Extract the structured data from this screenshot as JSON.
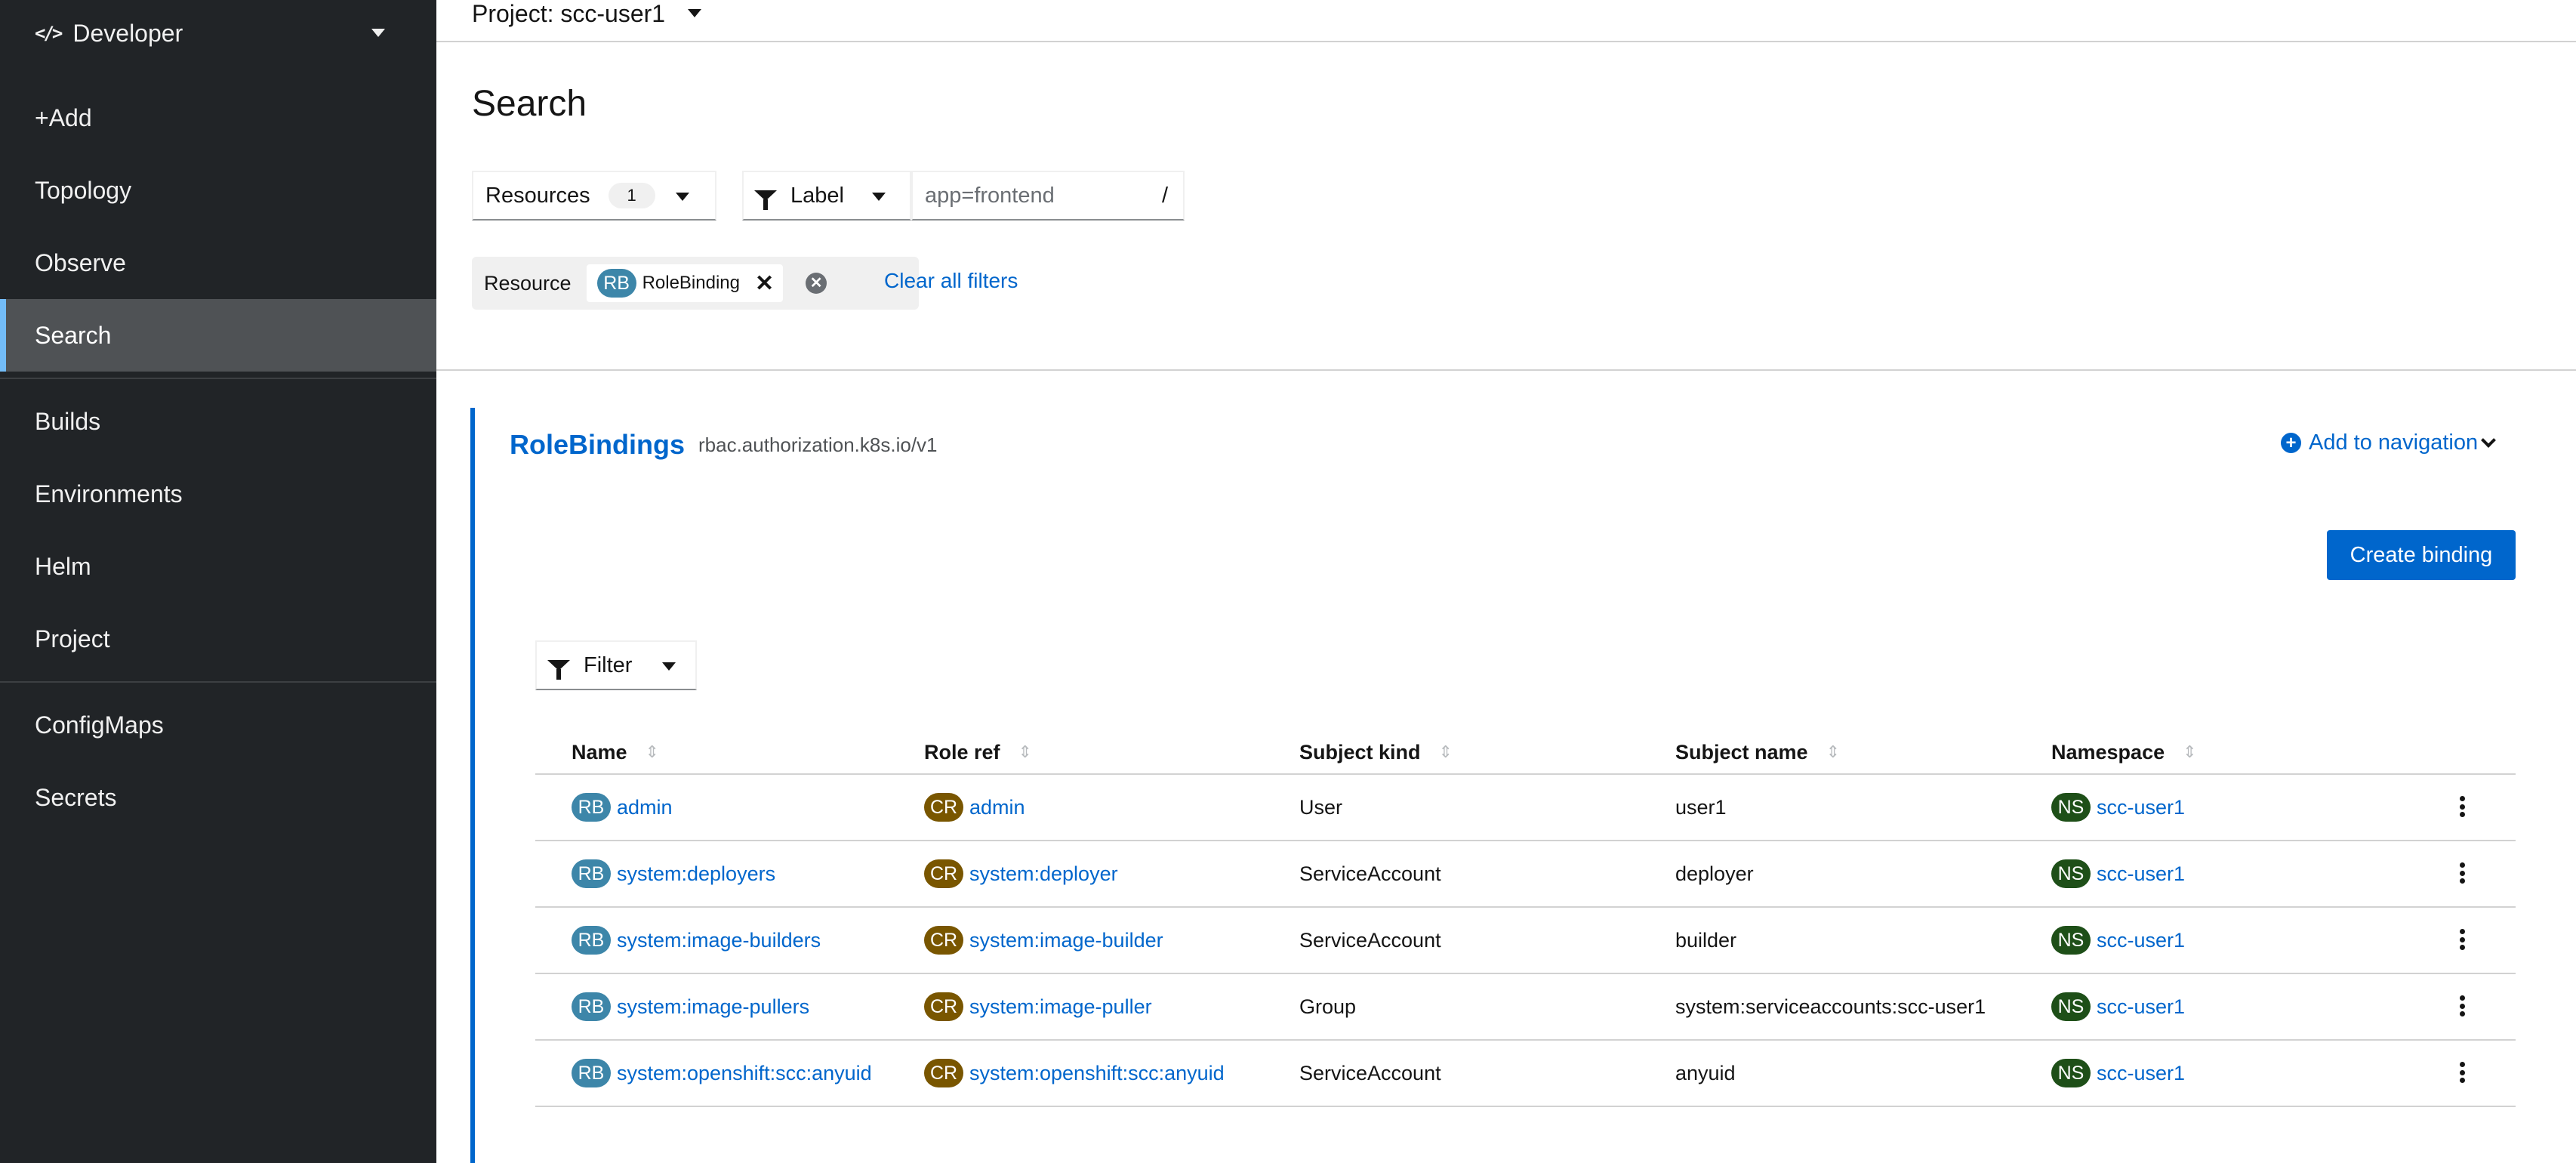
{
  "sidebar": {
    "perspective": "Developer",
    "items": [
      {
        "label": "+Add"
      },
      {
        "label": "Topology"
      },
      {
        "label": "Observe"
      },
      {
        "label": "Search"
      },
      {
        "label": "Builds"
      },
      {
        "label": "Environments"
      },
      {
        "label": "Helm"
      },
      {
        "label": "Project"
      },
      {
        "label": "ConfigMaps"
      },
      {
        "label": "Secrets"
      }
    ],
    "active": "Search"
  },
  "header": {
    "project": "Project: scc-user1"
  },
  "page": {
    "title": "Search",
    "resources_label": "Resources",
    "resources_count": "1",
    "label_dropdown": "Label",
    "label_placeholder": "app=frontend",
    "label_shortcut": "/",
    "filter_category": "Resource",
    "chip_badge": "RB",
    "chip_label": "RoleBinding",
    "clear_all": "Clear all filters"
  },
  "section": {
    "title": "RoleBindings",
    "api": "rbac.authorization.k8s.io/v1",
    "add_to_nav": "Add to navigation",
    "create_button": "Create binding",
    "filter_label": "Filter"
  },
  "table": {
    "columns": [
      "Name",
      "Role ref",
      "Subject kind",
      "Subject name",
      "Namespace"
    ],
    "rows": [
      {
        "name_badge": "RB",
        "name": "admin",
        "role_badge": "CR",
        "role": "admin",
        "kind": "User",
        "subject": "user1",
        "ns_badge": "NS",
        "namespace": "scc-user1"
      },
      {
        "name_badge": "RB",
        "name": "system:deployers",
        "role_badge": "CR",
        "role": "system:deployer",
        "kind": "ServiceAccount",
        "subject": "deployer",
        "ns_badge": "NS",
        "namespace": "scc-user1"
      },
      {
        "name_badge": "RB",
        "name": "system:image-builders",
        "role_badge": "CR",
        "role": "system:image-builder",
        "kind": "ServiceAccount",
        "subject": "builder",
        "ns_badge": "NS",
        "namespace": "scc-user1"
      },
      {
        "name_badge": "RB",
        "name": "system:image-pullers",
        "role_badge": "CR",
        "role": "system:image-puller",
        "kind": "Group",
        "subject": "system:serviceaccounts:scc-user1",
        "ns_badge": "NS",
        "namespace": "scc-user1"
      },
      {
        "name_badge": "RB",
        "name": "system:openshift:scc:anyuid",
        "role_badge": "CR",
        "role": "system:openshift:scc:anyuid",
        "kind": "ServiceAccount",
        "subject": "anyuid",
        "ns_badge": "NS",
        "namespace": "scc-user1"
      }
    ]
  },
  "colors": {
    "sidebar_bg": "#212427",
    "active_bg": "#4f5255",
    "accent": "#0066cc",
    "rb_badge": "#3d86a9",
    "cr_badge": "#795600",
    "ns_badge": "#1e4f18"
  }
}
